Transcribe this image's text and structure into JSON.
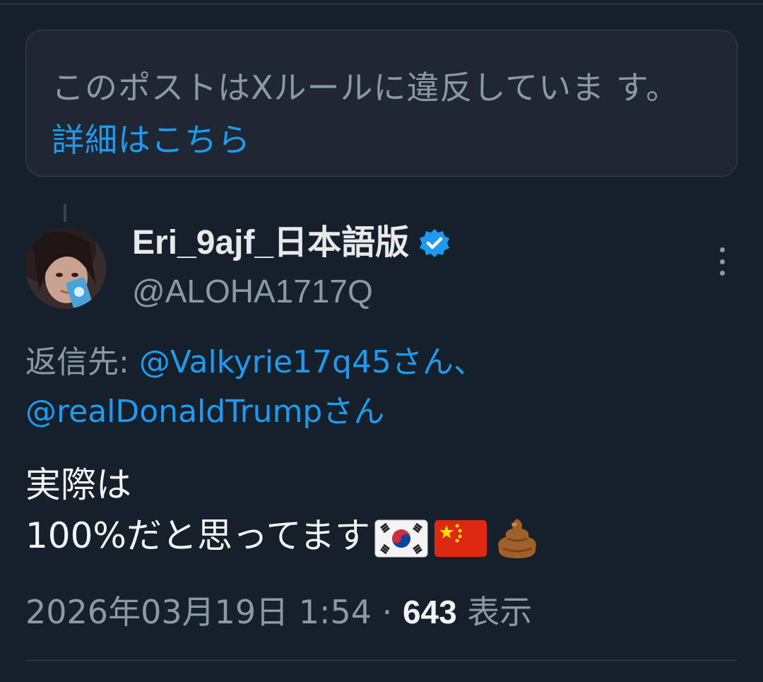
{
  "notice": {
    "text": "このポストはXルールに違反していま す。",
    "link_label": "詳細はこちら"
  },
  "author": {
    "display_name": "Eri_9ajf_日本語版",
    "handle": "@ALOHA1717Q",
    "verified": true
  },
  "reply": {
    "prefix": "返信先: ",
    "mentions": [
      "@Valkyrie17q45さん",
      "@realDonaldTrumpさん"
    ],
    "separator": "、"
  },
  "post": {
    "line1": "実際は",
    "line2": "100%だと思ってます",
    "emojis": [
      "south-korea-flag",
      "china-flag",
      "poop-emoji"
    ]
  },
  "meta": {
    "timestamp": "2026年03月19日 1:54",
    "dot": " · ",
    "views_count": "643",
    "views_label": " 表示"
  },
  "colors": {
    "background": "#15202b",
    "link": "#1d9bf0",
    "secondary_text": "#8b98a5",
    "primary_text": "#e7e9ea"
  }
}
